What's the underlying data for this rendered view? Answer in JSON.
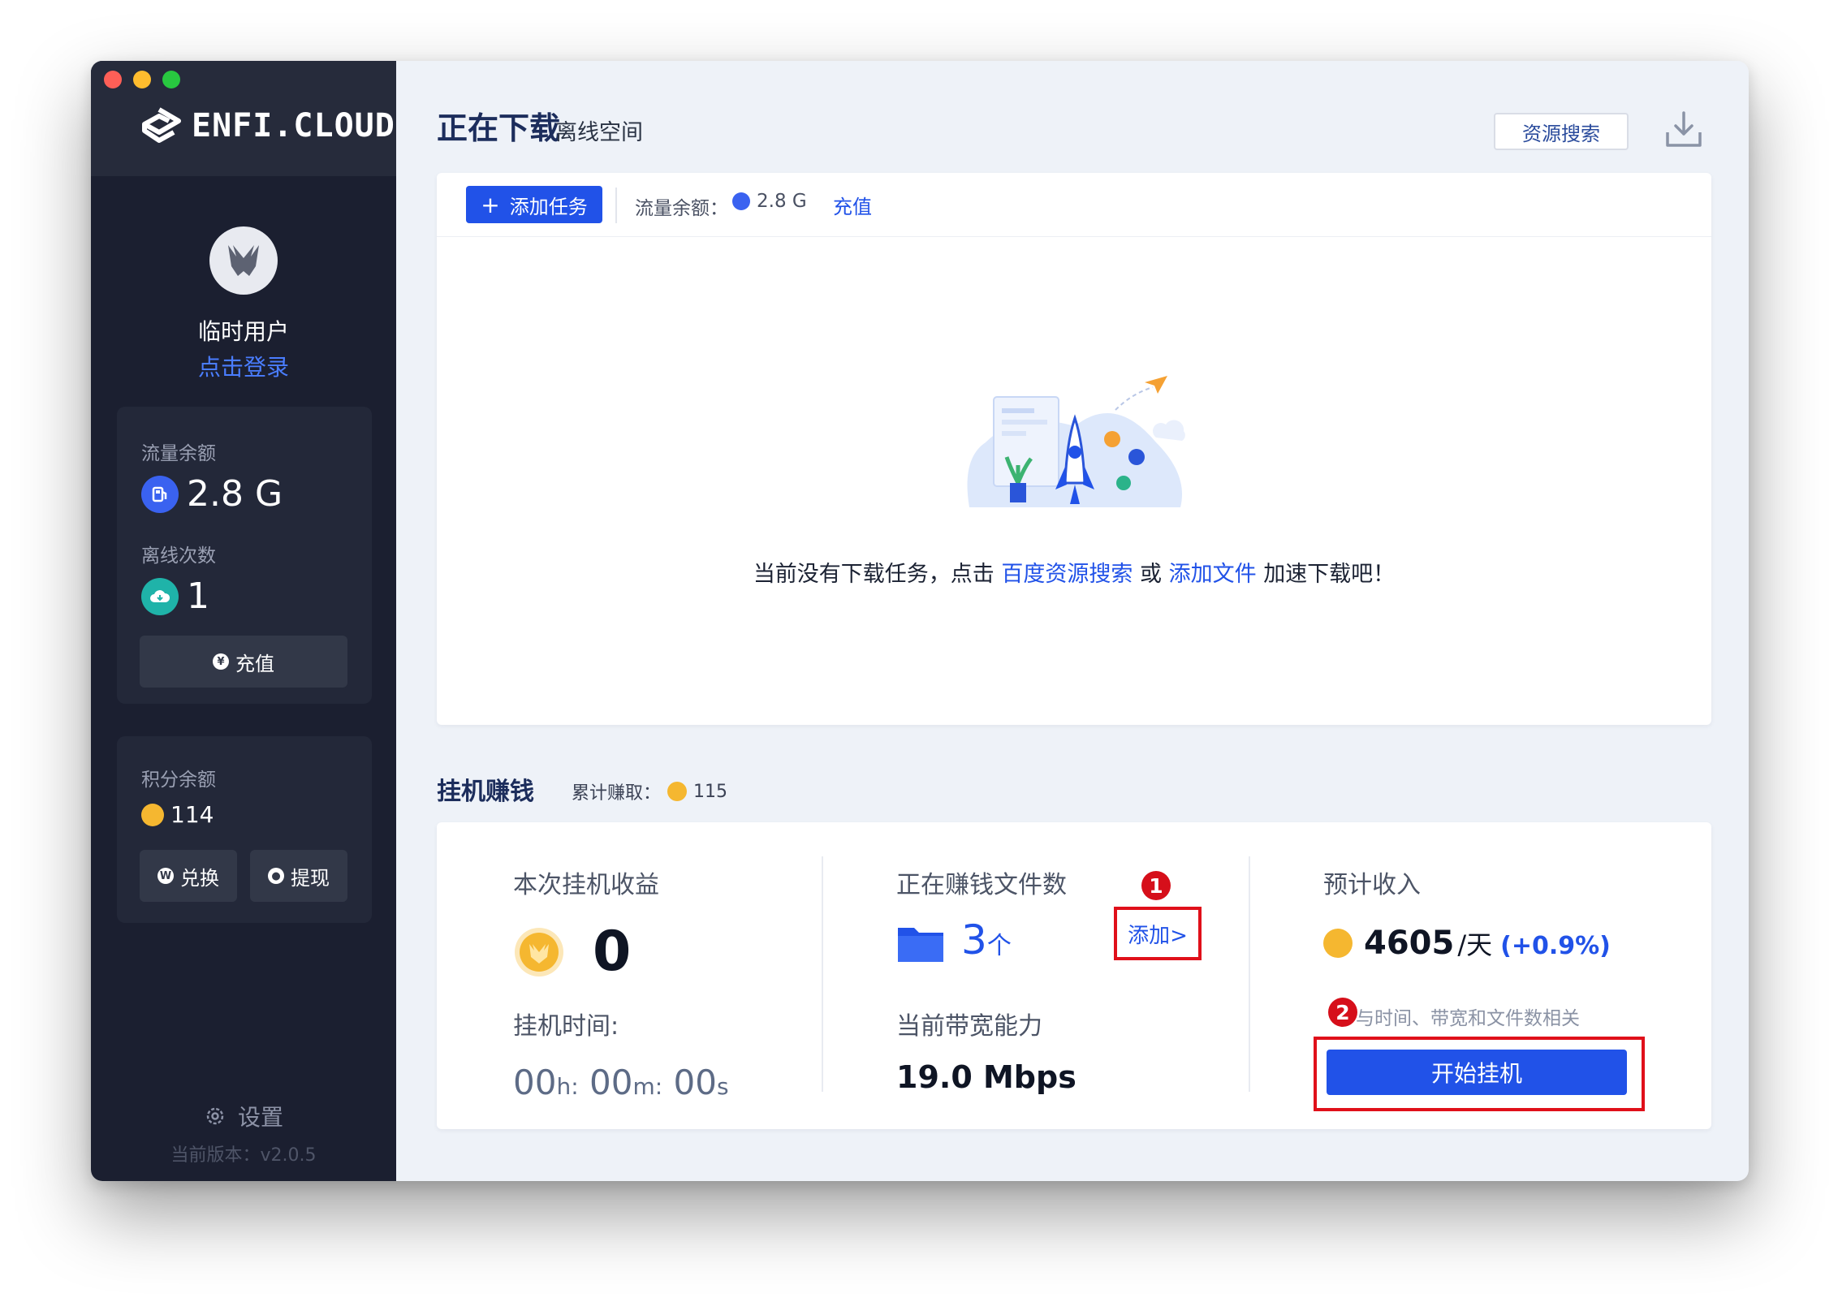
{
  "app": {
    "logo_text": "ENFI.CLOUD"
  },
  "colors": {
    "accent": "#2152e8",
    "sidebar_bg": "#1b1f30",
    "highlight_red": "#e0101a",
    "coin": "#f5b730"
  },
  "sidebar": {
    "username": "临时用户",
    "login_link": "点击登录",
    "traffic": {
      "label": "流量余额",
      "value": "2.8 G"
    },
    "offline": {
      "label": "离线次数",
      "value": "1"
    },
    "recharge_button": "充值",
    "points": {
      "label": "积分余额",
      "value": "114"
    },
    "exchange_button": "兑换",
    "withdraw_button": "提现",
    "settings_label": "设置",
    "version": "当前版本：v2.0.5"
  },
  "header": {
    "title": "正在下载",
    "tab_offline": "离线空间",
    "search_button": "资源搜索"
  },
  "download_panel": {
    "add_task_button": "添加任务",
    "traffic_label": "流量余额：",
    "traffic_value": "2.8 G",
    "recharge_link": "充值",
    "empty_prefix": "当前没有下载任务，点击",
    "empty_link_search": "百度资源搜索",
    "empty_or": "或",
    "empty_link_add": "添加文件",
    "empty_suffix": "加速下载吧！"
  },
  "earn": {
    "section_title": "挂机赚钱",
    "cumulative_label": "累计赚取：",
    "cumulative_value": "115",
    "session_label": "本次挂机收益",
    "session_value": "0",
    "time_label": "挂机时间:",
    "time_h": "00",
    "time_h_unit": "h:",
    "time_m": "00",
    "time_m_unit": "m:",
    "time_s": "00",
    "time_s_unit": "s",
    "files_label": "正在赚钱文件数",
    "files_count": "3",
    "files_unit": "个",
    "add_link": "添加>",
    "bandwidth_label": "当前带宽能力",
    "bandwidth_value": "19.0 Mbps",
    "estimate_label": "预计收入",
    "estimate_value": "4605",
    "estimate_unit": "/天",
    "estimate_change": "(+0.9%)",
    "hint": "与时间、带宽和文件数相关",
    "start_button": "开始挂机",
    "badge_1": "1",
    "badge_2": "2"
  }
}
